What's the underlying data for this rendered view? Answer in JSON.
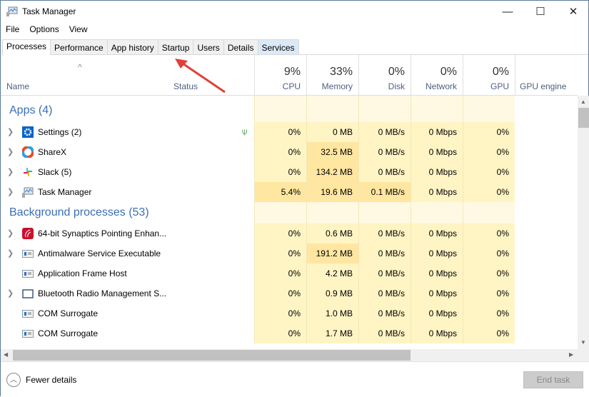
{
  "window": {
    "title": "Task Manager",
    "minimize": "—",
    "maximize": "☐",
    "close": "✕"
  },
  "menu": [
    "File",
    "Options",
    "View"
  ],
  "tabs": [
    "Processes",
    "Performance",
    "App history",
    "Startup",
    "Users",
    "Details",
    "Services"
  ],
  "columns": {
    "name": "Name",
    "status": "Status",
    "cpu_pct": "9%",
    "cpu": "CPU",
    "memory_pct": "33%",
    "memory": "Memory",
    "disk_pct": "0%",
    "disk": "Disk",
    "network_pct": "0%",
    "network": "Network",
    "gpu_pct": "0%",
    "gpu": "GPU",
    "gpu_engine": "GPU engine"
  },
  "groups": [
    {
      "title": "Apps (4)",
      "rows": [
        {
          "name": "Settings (2)",
          "icon": "settings-icon",
          "expand": true,
          "eco": true,
          "cpu": "0%",
          "mem": "0 MB",
          "disk": "0 MB/s",
          "net": "0 Mbps",
          "gpu": "0%"
        },
        {
          "name": "ShareX",
          "icon": "sharex-icon",
          "expand": true,
          "cpu": "0%",
          "mem": "32.5 MB",
          "disk": "0 MB/s",
          "net": "0 Mbps",
          "gpu": "0%"
        },
        {
          "name": "Slack (5)",
          "icon": "slack-icon",
          "expand": true,
          "cpu": "0%",
          "mem": "134.2 MB",
          "disk": "0 MB/s",
          "net": "0 Mbps",
          "gpu": "0%"
        },
        {
          "name": "Task Manager",
          "icon": "task-manager-icon",
          "expand": true,
          "cpu": "5.4%",
          "mem": "19.6 MB",
          "disk": "0.1 MB/s",
          "net": "0 Mbps",
          "gpu": "0%"
        }
      ]
    },
    {
      "title": "Background processes (53)",
      "rows": [
        {
          "name": "64-bit Synaptics Pointing Enhan...",
          "icon": "synaptics-icon",
          "expand": true,
          "cpu": "0%",
          "mem": "0.6 MB",
          "disk": "0 MB/s",
          "net": "0 Mbps",
          "gpu": "0%"
        },
        {
          "name": "Antimalware Service Executable",
          "icon": "service-icon",
          "expand": true,
          "cpu": "0%",
          "mem": "191.2 MB",
          "disk": "0 MB/s",
          "net": "0 Mbps",
          "gpu": "0%"
        },
        {
          "name": "Application Frame Host",
          "icon": "service-icon",
          "expand": false,
          "cpu": "0%",
          "mem": "4.2 MB",
          "disk": "0 MB/s",
          "net": "0 Mbps",
          "gpu": "0%"
        },
        {
          "name": "Bluetooth Radio Management S...",
          "icon": "window-icon",
          "expand": true,
          "cpu": "0%",
          "mem": "0.9 MB",
          "disk": "0 MB/s",
          "net": "0 Mbps",
          "gpu": "0%"
        },
        {
          "name": "COM Surrogate",
          "icon": "service-icon",
          "expand": false,
          "cpu": "0%",
          "mem": "1.0 MB",
          "disk": "0 MB/s",
          "net": "0 Mbps",
          "gpu": "0%"
        },
        {
          "name": "COM Surrogate",
          "icon": "service-icon",
          "expand": false,
          "cpu": "0%",
          "mem": "1.7 MB",
          "disk": "0 MB/s",
          "net": "0 Mbps",
          "gpu": "0%"
        }
      ]
    }
  ],
  "footer": {
    "fewer_details": "Fewer details",
    "end_task": "End task"
  }
}
